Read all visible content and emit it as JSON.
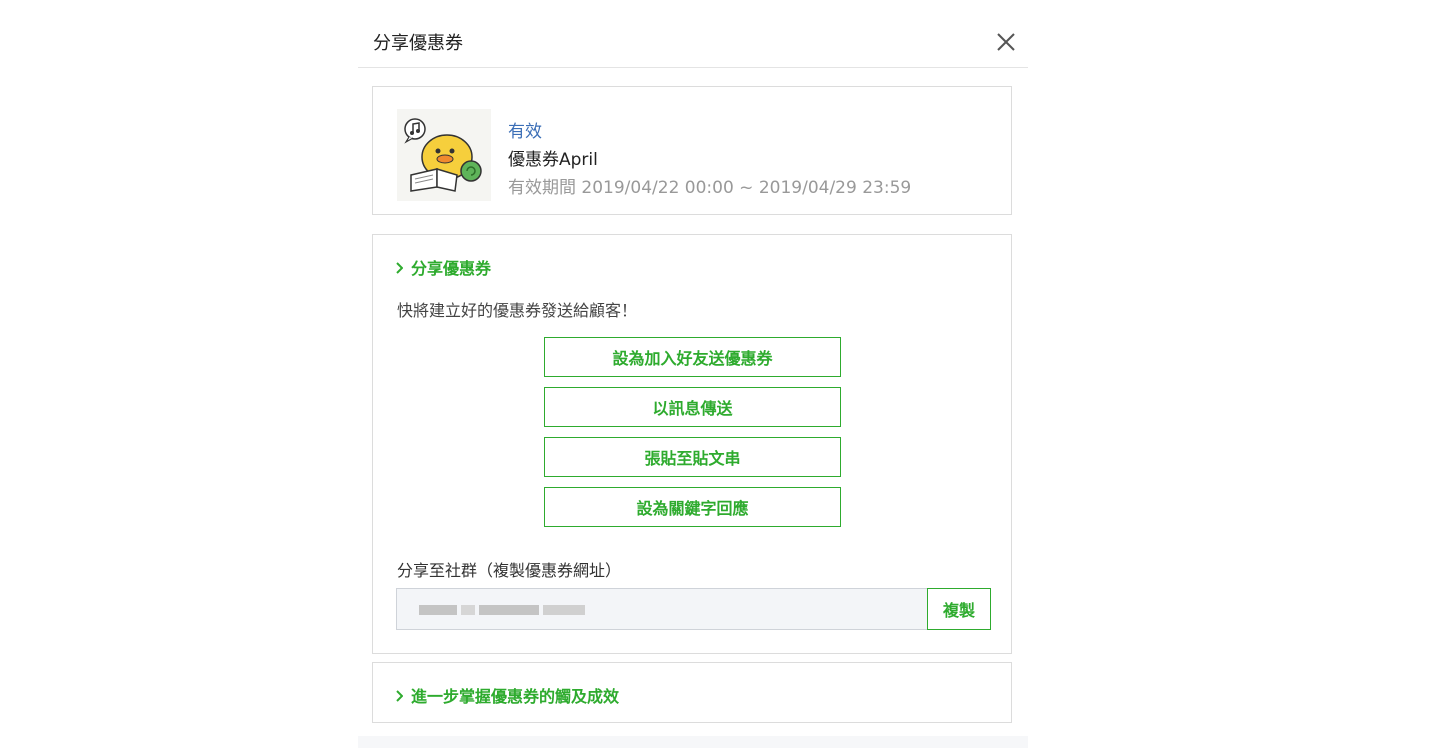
{
  "modal": {
    "title": "分享優惠券",
    "close_icon": "close-icon"
  },
  "coupon": {
    "status": "有效",
    "name": "優惠券April",
    "period": "有效期間 2019/04/22 00:00 ~ 2019/04/29 23:59",
    "thumbnail_icon": "duck-reading-book-illustration"
  },
  "share_section": {
    "toggle_label": "分享優惠券",
    "description": "快將建立好的優惠券發送給顧客！",
    "buttons": [
      "設為加入好友送優惠券",
      "以訊息傳送",
      "張貼至貼文串",
      "設為關鍵字回應"
    ],
    "social_label": "分享至社群（複製優惠券網址）",
    "copy_button": "複製"
  },
  "more_section": {
    "toggle_label": "進一步掌握優惠券的觸及成效"
  },
  "colors": {
    "accent_green": "#2eab2e",
    "status_blue": "#3b6eb6",
    "muted_text": "#999999"
  }
}
